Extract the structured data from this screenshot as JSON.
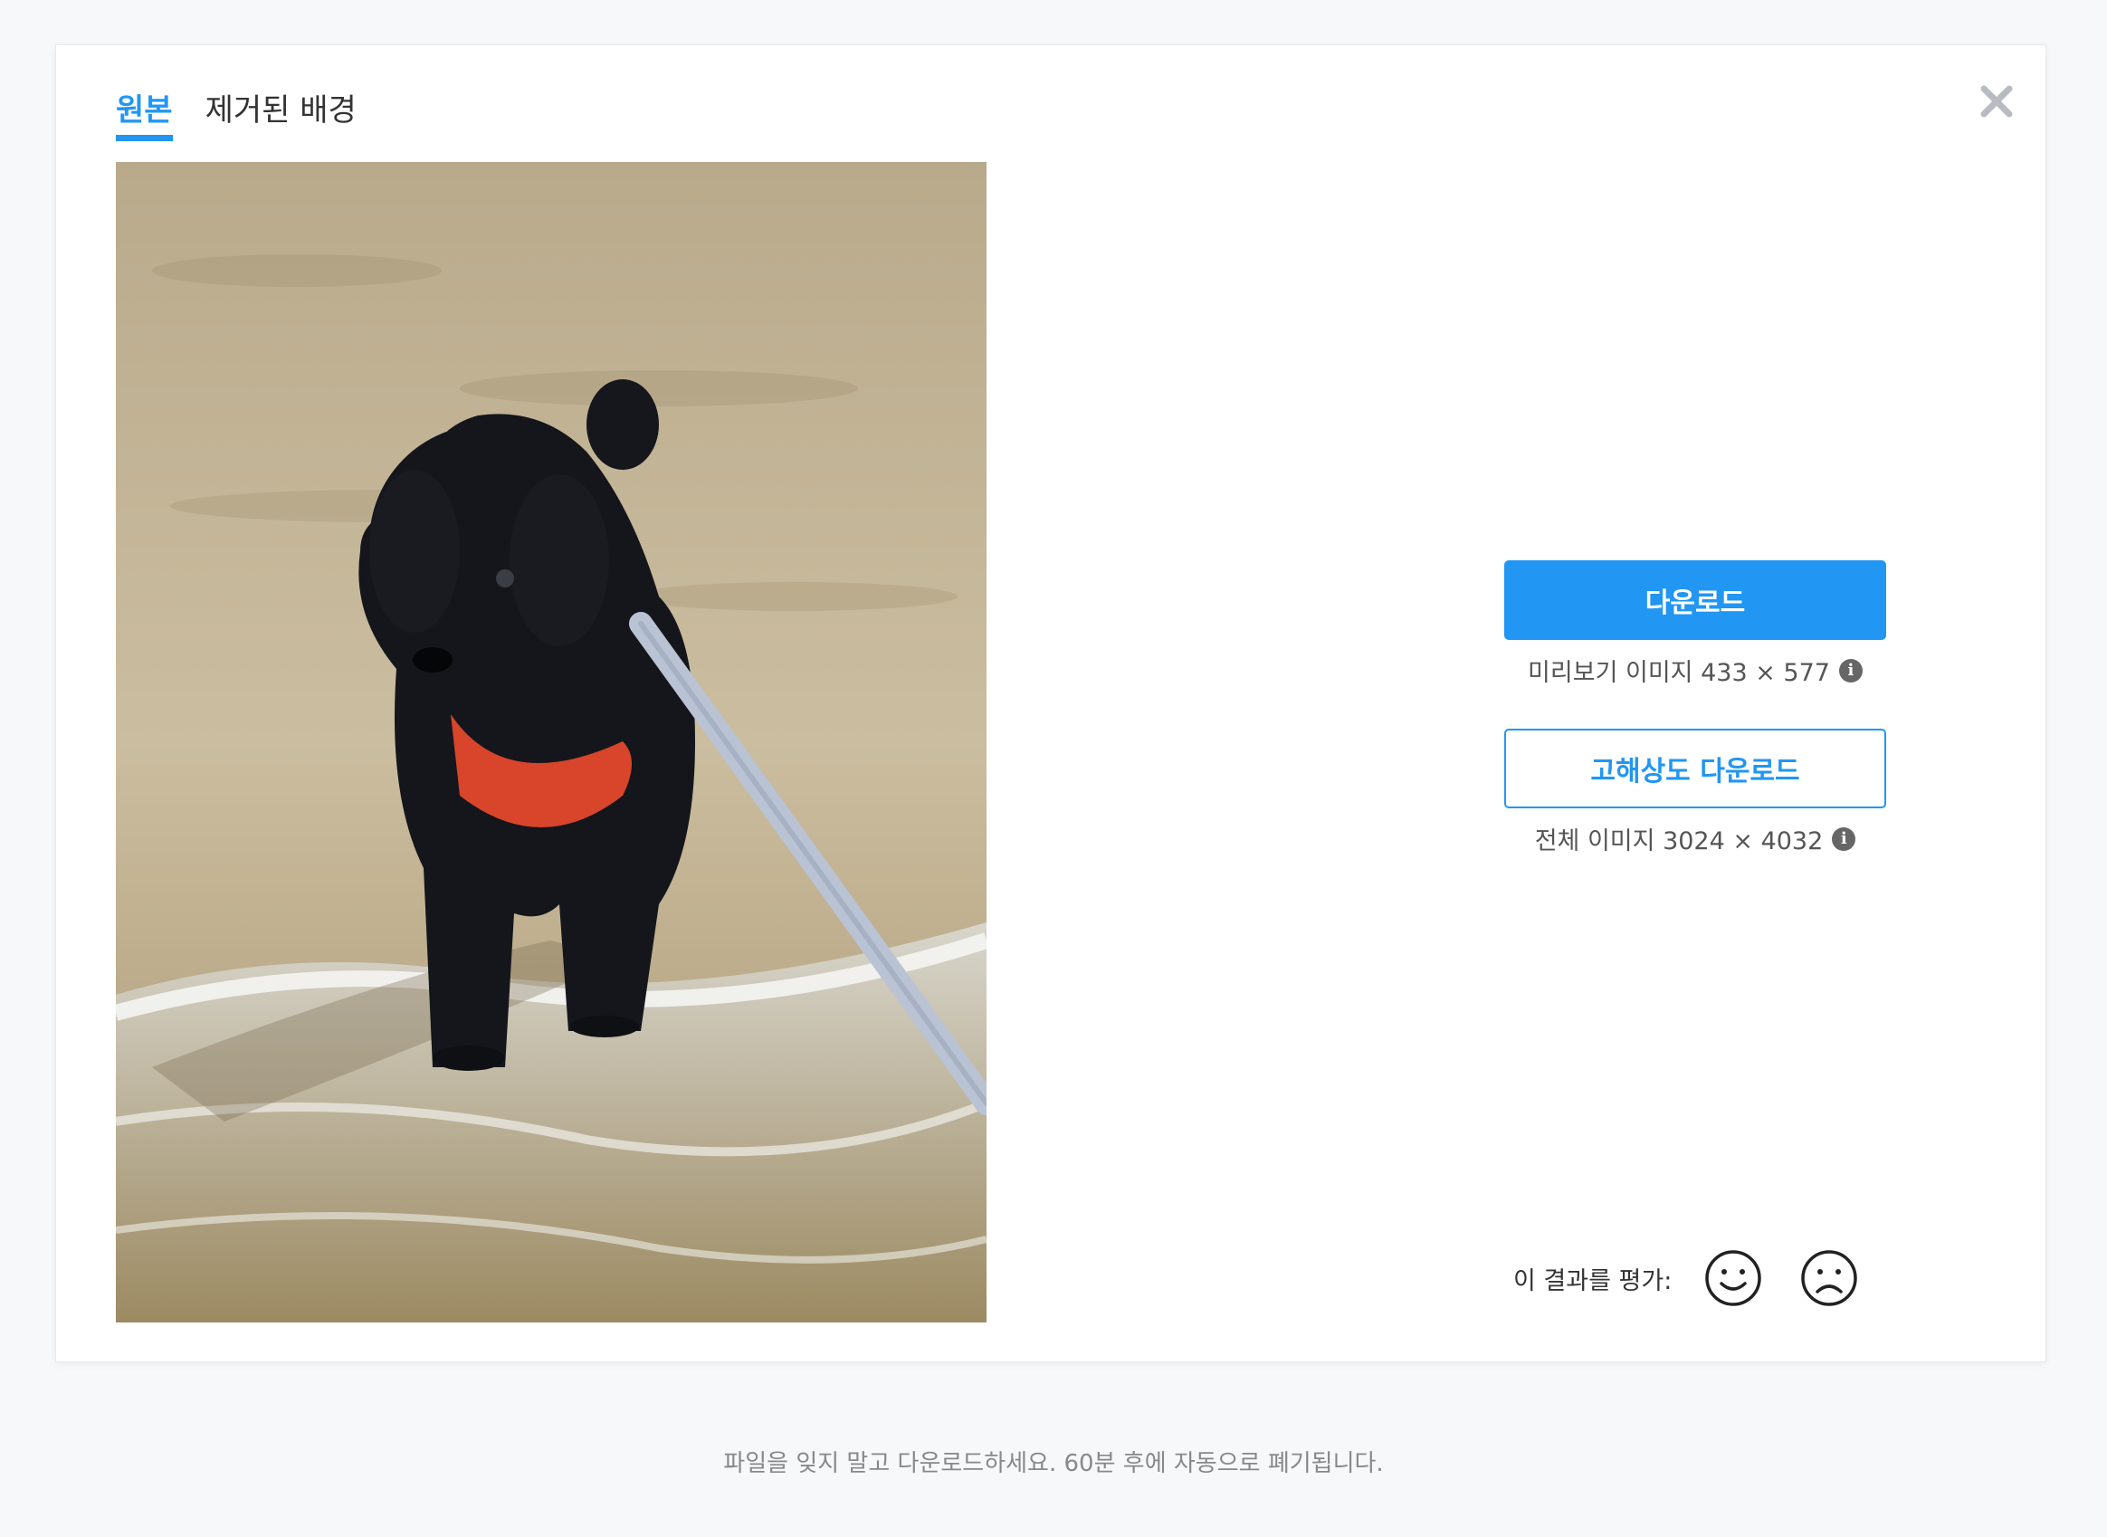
{
  "tabs": [
    {
      "label": "원본",
      "active": true
    },
    {
      "label": "제거된 배경",
      "active": false
    }
  ],
  "close_icon": "close-icon",
  "image": {
    "alt": "Black poodle puppy on beach",
    "kind": "photo"
  },
  "download": {
    "label": "다운로드",
    "meta": "미리보기 이미지 433 × 577"
  },
  "hd_download": {
    "label": "고해상도 다운로드",
    "meta": "전체 이미지 3024 × 4032"
  },
  "info_icon": "i",
  "rating": {
    "label": "이 결과를 평가:",
    "good_icon": "smile-icon",
    "bad_icon": "frown-icon"
  },
  "footer": "파일을 잊지 말고 다운로드하세요. 60분 후에 자동으로 폐기됩니다.",
  "colors": {
    "accent": "#2196f3",
    "background": "#f7f8fa"
  }
}
